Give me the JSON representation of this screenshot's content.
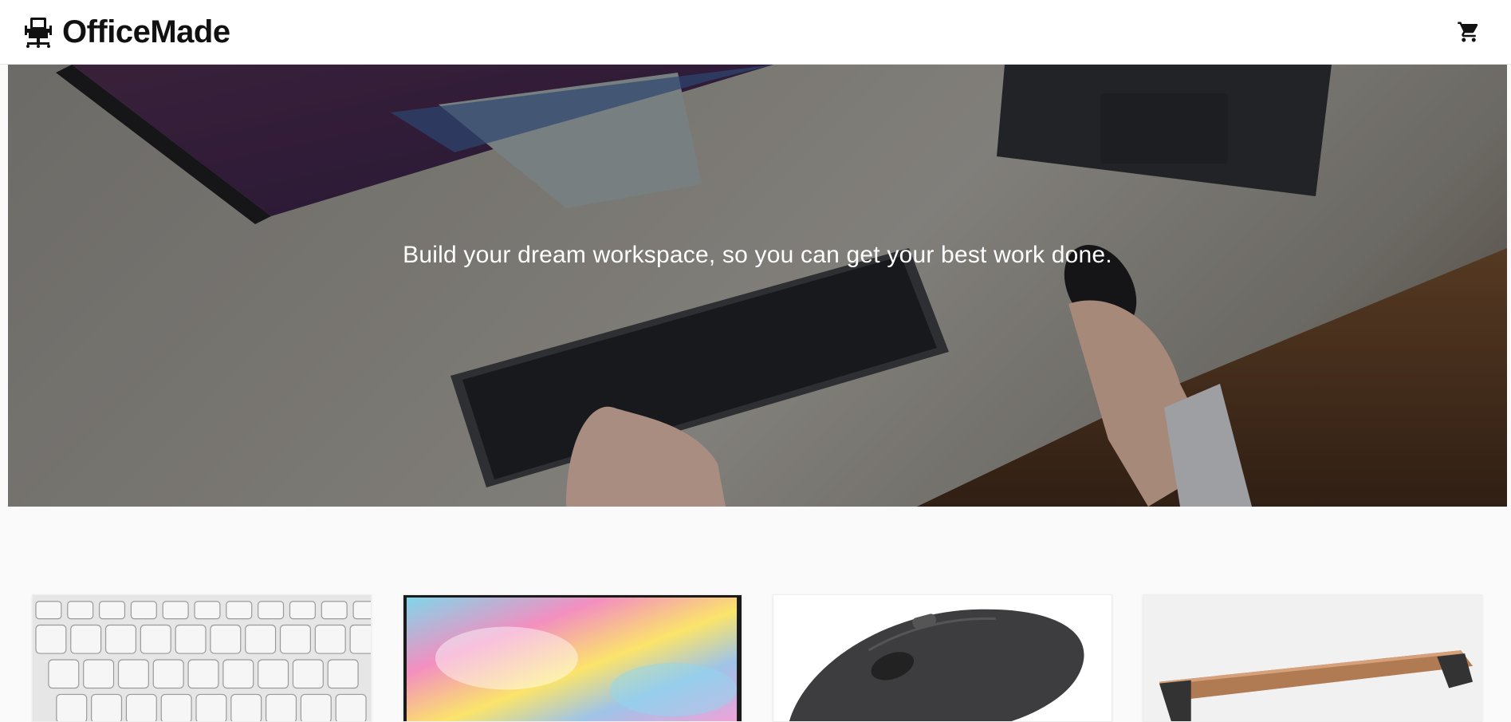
{
  "header": {
    "brand_name": "OfficeMade",
    "logo_icon": "office-chair-icon",
    "cart_icon": "shopping-cart-icon"
  },
  "hero": {
    "tagline": "Build your dream workspace, so you can get your best work done."
  },
  "products": [
    {
      "image": "keyboard-product-image"
    },
    {
      "image": "colorful-laptop-product-image"
    },
    {
      "image": "wireless-mouse-product-image"
    },
    {
      "image": "monitor-stand-product-image"
    }
  ],
  "colors": {
    "header_bg": "#ffffff",
    "page_bg": "#fafafa",
    "text": "#111111"
  }
}
